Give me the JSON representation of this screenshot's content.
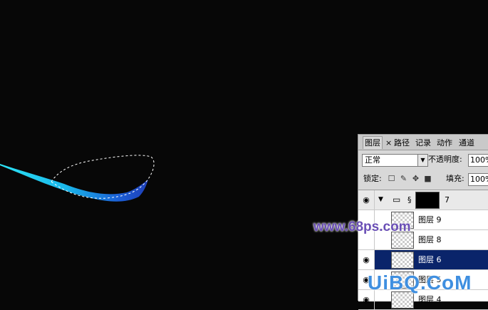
{
  "panel": {
    "tabs": [
      "图层",
      "×",
      "路径",
      "记录",
      "动作",
      "通道"
    ],
    "blend_mode": "正常",
    "opacity_label": "不透明度:",
    "opacity_value": "100%",
    "lock_label": "锁定:",
    "fill_label": "填充:",
    "fill_value": "100%"
  },
  "layers": [
    {
      "name": "7",
      "type": "group",
      "visible": true
    },
    {
      "name": "图层 9",
      "visible": false
    },
    {
      "name": "图层 8",
      "visible": false
    },
    {
      "name": "图层 6",
      "visible": true,
      "selected": true
    },
    {
      "name": "图层 5",
      "visible": true
    },
    {
      "name": "图层 4",
      "visible": true
    }
  ],
  "watermarks": {
    "site1": "www.68ps.com",
    "site2": "UiBQ.CoM"
  },
  "colors": {
    "canvas_bg": "#070707",
    "selected_row": "#0a246a",
    "stroke_light": "#37d6f0",
    "stroke_dark": "#1f3fb8",
    "watermark1": "#6a4fb6"
  }
}
